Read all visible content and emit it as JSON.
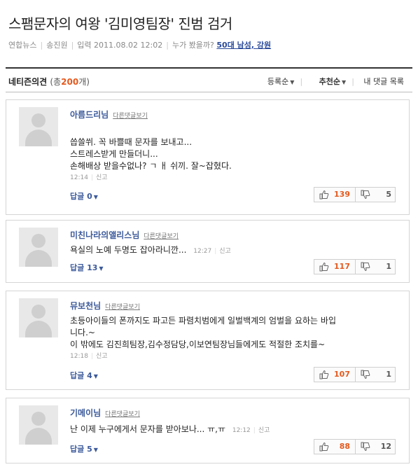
{
  "article": {
    "title": "스팸문자의 여왕 '김미영팀장' 진범 검거",
    "source": "연합뉴스",
    "reporter": "송진원",
    "date_label": "입력",
    "date": "2011.08.02 12:02",
    "who_read_label": "누가 봤을까?",
    "who_read_value": "50대 남성, 강원"
  },
  "comments_header": {
    "title": "네티즌의견",
    "count_prefix": "(총",
    "count": "200",
    "count_suffix": "개)",
    "sort_registered": "등록순",
    "sort_recommended": "추천순",
    "my_comments": "내 댓글 목록"
  },
  "comments": [
    {
      "author": "아름드리님",
      "view_all": "다른댓글보기",
      "lines": [
        "씁쓸쒸. 꼭 바쁠때 문자를 보내고...",
        "스트레스받게 만들더니...",
        "손해배상 받을수없나? ㄱ ㅐ 쉬끼. 잘~잡혔다."
      ],
      "time": "12:14",
      "report": "신고",
      "replies_label": "답글 0",
      "up": "139",
      "down": "5"
    },
    {
      "author": "미친나라의앨리스님",
      "view_all": "다른댓글보기",
      "lines": [
        "욕실의 노예 두명도 잡아라니깐..."
      ],
      "time": "12:27",
      "report": "신고",
      "replies_label": "답글 13",
      "up": "117",
      "down": "1"
    },
    {
      "author": "뮤보천님",
      "view_all": "다른댓글보기",
      "lines": [
        "초등아이들의 폰까지도 파고든 파렴치범에게 일벌백계의 엄벌을 요하는 바입",
        "니다.~",
        "이 밖에도 김진희팀장,김수정담당,이보연팀장님들에게도 적절한 조치를~"
      ],
      "time": "12:18",
      "report": "신고",
      "replies_label": "답글 4",
      "up": "107",
      "down": "1"
    },
    {
      "author": "기메이님",
      "view_all": "다른댓글보기",
      "lines": [
        "난 이제 누구에게서 문자를 받아보나... ㅠ,ㅠ"
      ],
      "time": "12:12",
      "report": "신고",
      "replies_label": "답글 5",
      "up": "88",
      "down": "12"
    }
  ]
}
